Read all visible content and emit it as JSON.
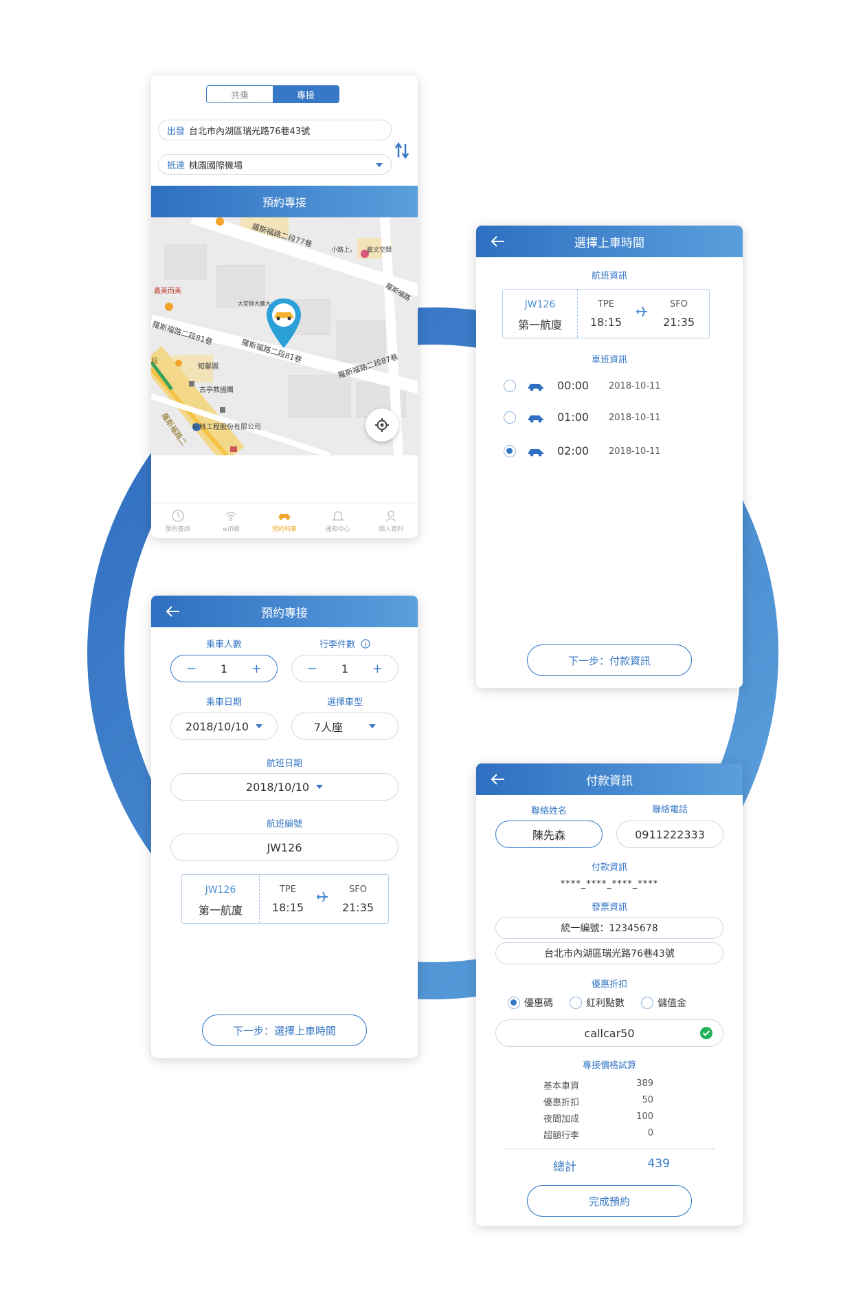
{
  "colors": {
    "brand_blue": "#3677c6",
    "accent_orange": "#f0a52a",
    "success_green": "#23b35a"
  },
  "screen_map": {
    "segment": {
      "shared": "共乘",
      "private": "專接"
    },
    "origin": {
      "label": "出發",
      "value": "台北市內湖區瑞光路76巷43號"
    },
    "destination": {
      "label": "抵達",
      "value": "桃園國際機場"
    },
    "book_button": "預約專接",
    "map_labels": {
      "road1": "羅斯福路二段77巷",
      "road2": "羅斯福路二段81巷",
      "road3": "羅斯福路二段81巷",
      "road4": "羅斯福路二段87巷",
      "road5": "羅斯福路",
      "road6": "羅斯福路二段81巷",
      "road7": "羅斯福路二",
      "shop1": "小路上。",
      "shop2": "藝文空間",
      "shop3": "大安師大鹿大",
      "shop4": "知馨園",
      "shop5": "古亭救國團",
      "shop6": "昭林工程股份有限公司",
      "shop7": "鑫美而美",
      "road_left": "段"
    },
    "tabs": [
      {
        "label": "預約查詢",
        "icon": "clock-icon"
      },
      {
        "label": "wifi機",
        "icon": "wifi-icon"
      },
      {
        "label": "預約叫車",
        "icon": "car-icon"
      },
      {
        "label": "通知中心",
        "icon": "bell-icon"
      },
      {
        "label": "個人資料",
        "icon": "user-icon"
      }
    ]
  },
  "screen_time": {
    "title": "選擇上車時間",
    "flight_section": "航班資訊",
    "flight": {
      "code": "JW126",
      "terminal": "第一航廈",
      "from": "TPE",
      "dep": "18:15",
      "to": "SFO",
      "arr": "21:35"
    },
    "shuttle_section": "車班資訊",
    "slots": [
      {
        "time": "00:00",
        "date": "2018-10-11",
        "selected": false
      },
      {
        "time": "01:00",
        "date": "2018-10-11",
        "selected": false
      },
      {
        "time": "02:00",
        "date": "2018-10-11",
        "selected": true
      }
    ],
    "next_button": "下一步：付款資訊"
  },
  "screen_booking": {
    "title": "預約專接",
    "passengers_label": "乘車人數",
    "passengers": "1",
    "luggage_label": "行李件數",
    "luggage": "1",
    "minus": "−",
    "plus": "+",
    "date_label": "乘車日期",
    "date": "2018/10/10",
    "car_type_label": "選擇車型",
    "car_type": "7人座",
    "flight_date_label": "航班日期",
    "flight_date": "2018/10/10",
    "flight_no_label": "航班編號",
    "flight_no": "JW126",
    "flight": {
      "code": "JW126",
      "terminal": "第一航廈",
      "from": "TPE",
      "dep": "18:15",
      "to": "SFO",
      "arr": "21:35"
    },
    "next_button": "下一步：選擇上車時間"
  },
  "screen_payment": {
    "title": "付款資訊",
    "name_label": "聯絡姓名",
    "name": "陳先森",
    "phone_label": "聯絡電話",
    "phone": "0911222333",
    "payment_label": "付款資訊",
    "card": "****_****_****_****",
    "invoice_label": "發票資訊",
    "tax_id": "統一編號：12345678",
    "address": "台北市內湖區瑞光路76巷43號",
    "discount_label": "優惠折扣",
    "discount_options": [
      "優惠碼",
      "紅利點數",
      "儲值金"
    ],
    "coupon": "callcar50",
    "estimate_label": "專接價格試算",
    "prices": [
      {
        "label": "基本車資",
        "value": "389"
      },
      {
        "label": "優惠折扣",
        "value": "50"
      },
      {
        "label": "夜間加成",
        "value": "100"
      },
      {
        "label": "超額行李",
        "value": "0"
      }
    ],
    "total_label": "總計",
    "total": "439",
    "submit_button": "完成預約"
  }
}
